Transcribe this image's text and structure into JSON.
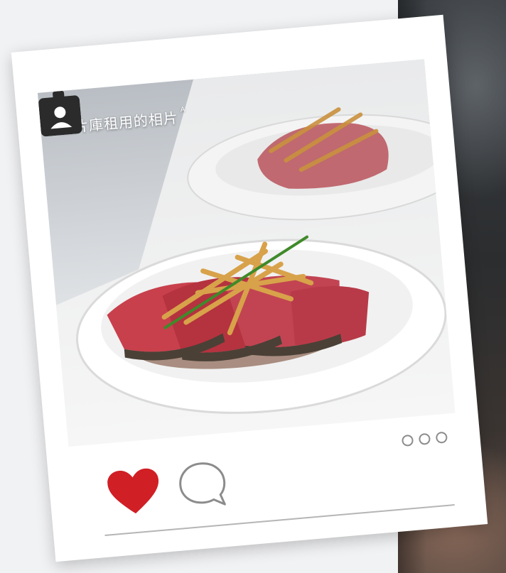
{
  "watermark": {
    "text": "圖片庫租用的相片",
    "marker": "A"
  },
  "icons": {
    "badge": "person-badge-icon",
    "like": "heart-icon",
    "comment": "comment-bubble-icon",
    "more": "more-options-icon"
  },
  "colors": {
    "like_heart": "#d01f25",
    "badge": "#2b2b2b",
    "card": "#ffffff",
    "icon_outline": "#8c8c8c"
  }
}
